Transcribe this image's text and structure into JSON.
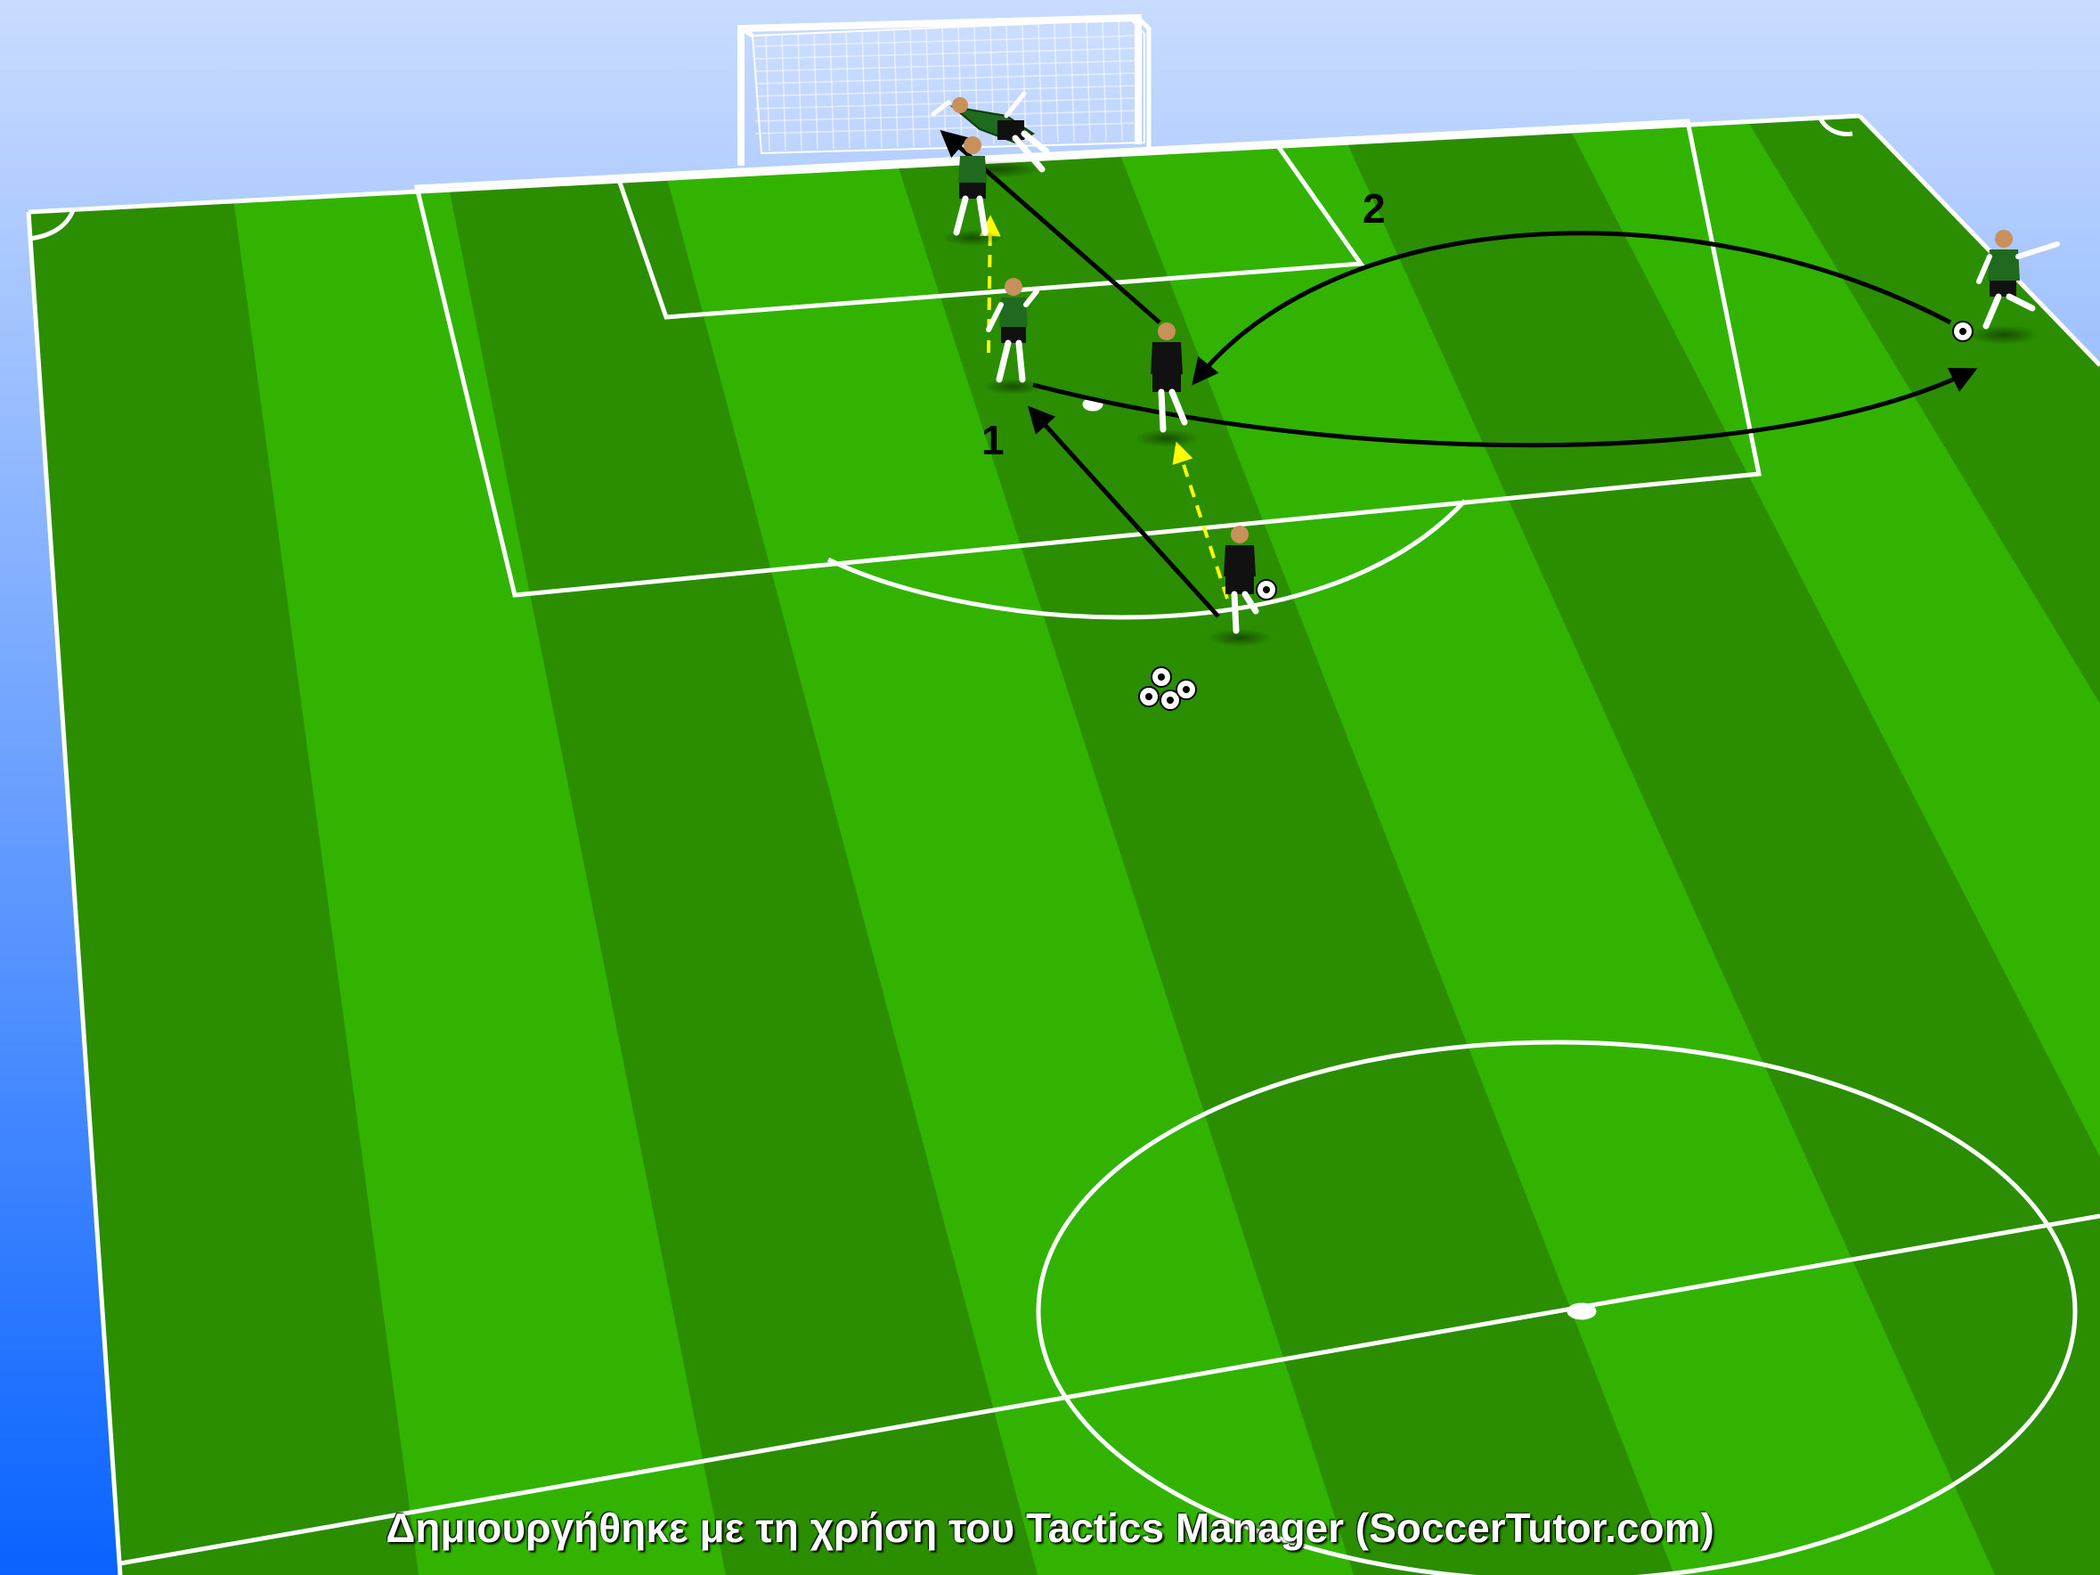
{
  "diagram": {
    "labels": {
      "phase_1": "1",
      "phase_2": "2"
    },
    "players": [
      {
        "id": "keeper",
        "team": "green",
        "role": "goalkeeper",
        "has_ball": false
      },
      {
        "id": "defender-near-goal",
        "team": "green",
        "role": "defender",
        "has_ball": false
      },
      {
        "id": "defender-box",
        "team": "green",
        "role": "defender",
        "has_ball": false
      },
      {
        "id": "attacker-box",
        "team": "black",
        "role": "attacker",
        "has_ball": false
      },
      {
        "id": "attacker-with-ball",
        "team": "black",
        "role": "attacker",
        "has_ball": true
      },
      {
        "id": "server-right",
        "team": "green",
        "role": "server",
        "has_ball": true
      }
    ],
    "ball_pile_count": 4,
    "colors": {
      "sky_top": "#c9dcff",
      "sky_bottom": "#0a63ff",
      "grass_dark": "#2a8e00",
      "grass_light": "#31b300",
      "lines": "#ffffff",
      "team_green": "#1f6a1f",
      "team_black": "#111111",
      "pass_arrow": "#000000",
      "run_arrow": "#ffff00"
    }
  },
  "caption": "Δημιουργήθηκε με τη χρήση του Tactics Manager (SoccerTutor.com)"
}
